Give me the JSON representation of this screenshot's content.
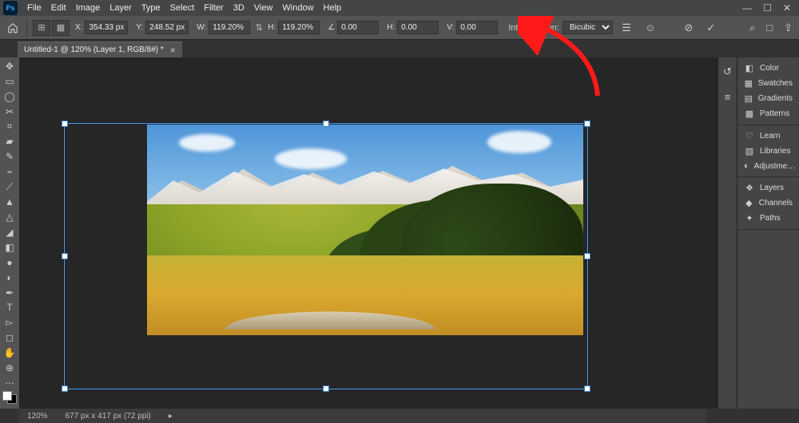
{
  "menu": {
    "items": [
      "File",
      "Edit",
      "Image",
      "Layer",
      "Type",
      "Select",
      "Filter",
      "3D",
      "View",
      "Window",
      "Help"
    ]
  },
  "options": {
    "x": "354.33 px",
    "y": "248.52 px",
    "w": "119.20%",
    "h": "119.20%",
    "angle": "0.00",
    "skew_h": "0.00",
    "skew_v": "0.00",
    "interp_label": "Interpolation:",
    "interp_value": "Bicubic"
  },
  "tab": {
    "title": "Untitled-1 @ 120% (Layer 1, RGB/8#) *"
  },
  "panels": {
    "group1": [
      {
        "icon": "◧",
        "label": "Color"
      },
      {
        "icon": "▦",
        "label": "Swatches"
      },
      {
        "icon": "▤",
        "label": "Gradients"
      },
      {
        "icon": "▩",
        "label": "Patterns"
      }
    ],
    "group2": [
      {
        "icon": "♡",
        "label": "Learn"
      },
      {
        "icon": "▧",
        "label": "Libraries"
      },
      {
        "icon": "◐",
        "label": "Adjustme…"
      }
    ],
    "group3": [
      {
        "icon": "❖",
        "label": "Layers"
      },
      {
        "icon": "◆",
        "label": "Channels"
      },
      {
        "icon": "✦",
        "label": "Paths"
      }
    ]
  },
  "status": {
    "zoom": "120%",
    "doc": "677 px x 417 px (72 ppi)"
  },
  "tools": [
    "↖",
    "▭",
    "◯",
    "✂",
    "⌗",
    "▰",
    "✎",
    "⌁",
    "⟋",
    "✥",
    "△",
    "●",
    "◢",
    "T",
    "▻",
    "✦",
    "✋",
    "�független",
    "⊕",
    "⋯"
  ]
}
